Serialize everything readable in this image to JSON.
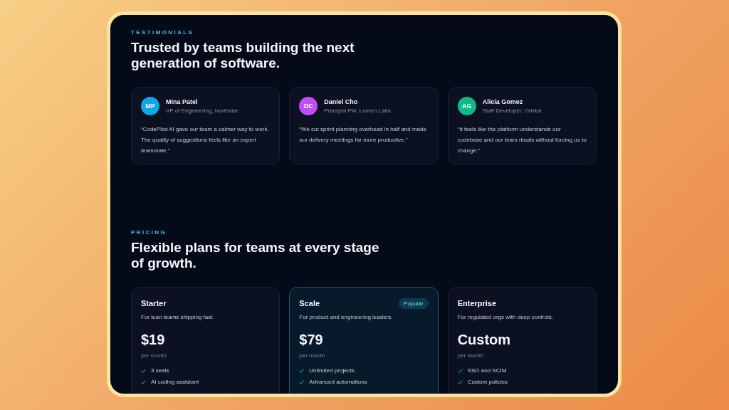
{
  "testimonials": {
    "eyebrow": "TESTIMONIALS",
    "heading": "Trusted by teams building the next generation of software.",
    "items": [
      {
        "initials": "MP",
        "color": "#0ea5e9",
        "name": "Mina Patel",
        "role": "VP of Engineering, Northstar",
        "quote": "“CodePilot AI gave our team a calmer way to work. The quality of suggestions feels like an expert teammate.”"
      },
      {
        "initials": "DC",
        "color": "#c04cf5",
        "name": "Daniel Cho",
        "role": "Principal PM, Lumen Labs",
        "quote": "“We cut sprint planning overhead in half and made our delivery meetings far more productive.”"
      },
      {
        "initials": "AG",
        "color": "#10b98a",
        "name": "Alicia Gomez",
        "role": "Staff Developer, Orbital",
        "quote": "“It feels like the platform understands our codebase and our team rituals without forcing us to change.”"
      }
    ]
  },
  "pricing": {
    "eyebrow": "PRICING",
    "heading": "Flexible plans for teams at every stage of growth.",
    "plans": [
      {
        "name": "Starter",
        "featured": false,
        "description": "For lean teams shipping fast.",
        "price": "$19",
        "period": "per month",
        "features": [
          "3 seats",
          "AI coding assistant"
        ]
      },
      {
        "name": "Scale",
        "featured": true,
        "badge": "Popular",
        "description": "For product and engineering leaders.",
        "price": "$79",
        "period": "per month",
        "features": [
          "Unlimited projects",
          "Advanced automations"
        ]
      },
      {
        "name": "Enterprise",
        "featured": false,
        "description": "For regulated orgs with deep controls.",
        "price": "Custom",
        "period": "per month",
        "features": [
          "SSO and SCIM",
          "Custom policies"
        ]
      }
    ]
  }
}
